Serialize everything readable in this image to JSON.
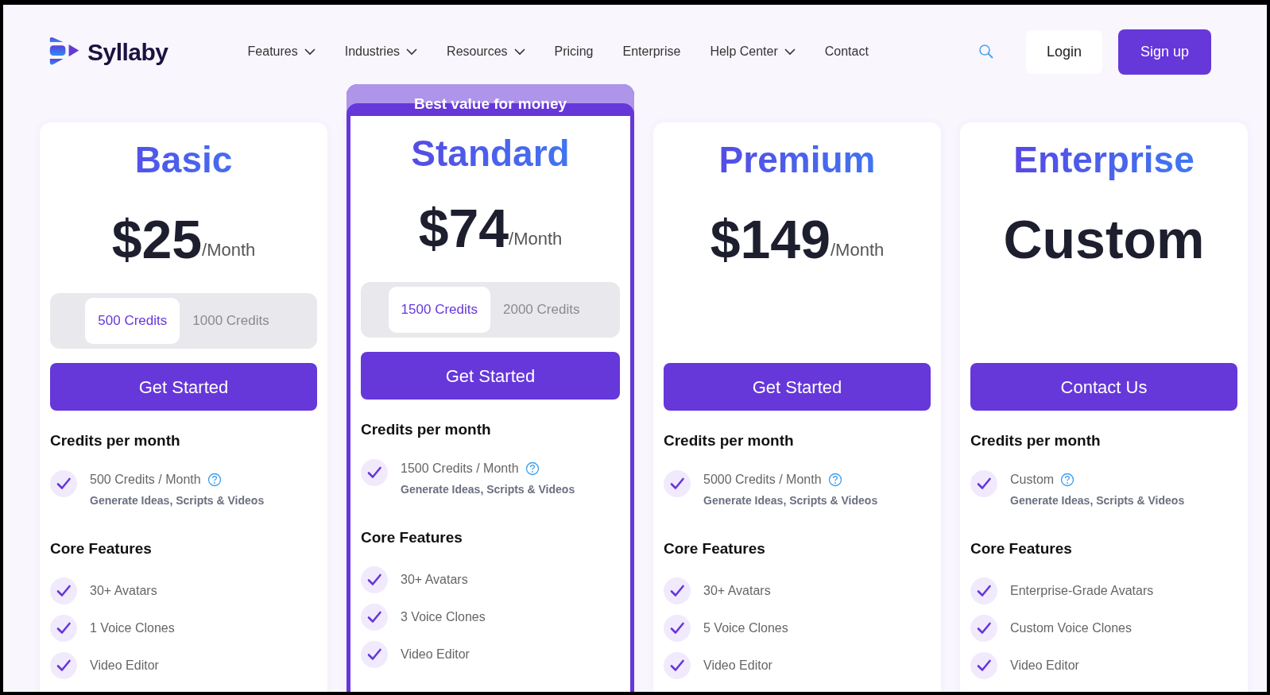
{
  "brand": "Syllaby",
  "nav": [
    {
      "label": "Features",
      "dropdown": true
    },
    {
      "label": "Industries",
      "dropdown": true
    },
    {
      "label": "Resources",
      "dropdown": true
    },
    {
      "label": "Pricing",
      "dropdown": false
    },
    {
      "label": "Enterprise",
      "dropdown": false
    },
    {
      "label": "Help Center",
      "dropdown": true
    },
    {
      "label": "Contact",
      "dropdown": false
    }
  ],
  "login": "Login",
  "signup": "Sign up",
  "plans": [
    {
      "name": "Basic",
      "featured": false,
      "price": "$25",
      "period": "/Month",
      "credit_options": [
        {
          "label": "500 Credits",
          "selected": true
        },
        {
          "label": "1000 Credits",
          "selected": false
        }
      ],
      "button": "Get Started",
      "credits_heading": "Credits per month",
      "credits": "500 Credits / Month",
      "credits_note": "Generate Ideas, Scripts & Videos",
      "features_heading": "Core Features",
      "features": [
        "30+ Avatars",
        "1 Voice Clones",
        "Video Editor"
      ]
    },
    {
      "name": "Standard",
      "featured": true,
      "badge": "Best value for money",
      "price": "$74",
      "period": "/Month",
      "credit_options": [
        {
          "label": "1500 Credits",
          "selected": true
        },
        {
          "label": "2000 Credits",
          "selected": false
        }
      ],
      "button": "Get Started",
      "credits_heading": "Credits per month",
      "credits": "1500 Credits / Month",
      "credits_note": "Generate Ideas, Scripts & Videos",
      "features_heading": "Core Features",
      "features": [
        "30+ Avatars",
        "3 Voice Clones",
        "Video Editor"
      ]
    },
    {
      "name": "Premium",
      "featured": false,
      "price": "$149",
      "period": "/Month",
      "button": "Get Started",
      "credits_heading": "Credits per month",
      "credits": "5000 Credits / Month",
      "credits_note": "Generate Ideas, Scripts & Videos",
      "features_heading": "Core Features",
      "features": [
        "30+ Avatars",
        "5 Voice Clones",
        "Video Editor"
      ]
    },
    {
      "name": "Enterprise",
      "featured": false,
      "price": "Custom",
      "button": "Contact Us",
      "credits_heading": "Credits per month",
      "credits": "Custom",
      "credits_note": "Generate Ideas, Scripts & Videos",
      "features_heading": "Core Features",
      "features": [
        "Enterprise-Grade Avatars",
        "Custom Voice Clones",
        "Video Editor"
      ]
    }
  ]
}
